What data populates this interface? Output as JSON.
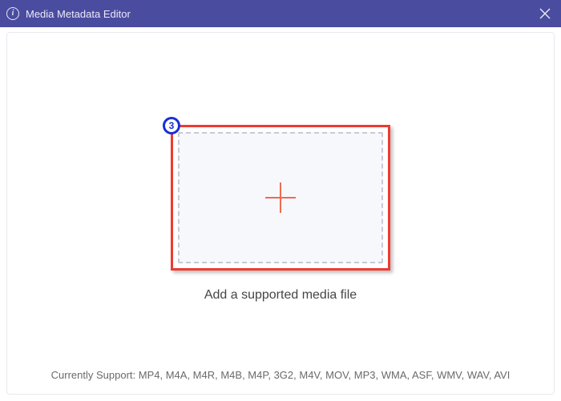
{
  "titlebar": {
    "title": "Media Metadata Editor"
  },
  "step": {
    "number": "3"
  },
  "drop": {
    "caption": "Add a supported media file"
  },
  "footer": {
    "text": "Currently Support: MP4, M4A, M4R, M4B, M4P, 3G2, M4V, MOV, MP3, WMA, ASF, WMV, WAV, AVI"
  }
}
